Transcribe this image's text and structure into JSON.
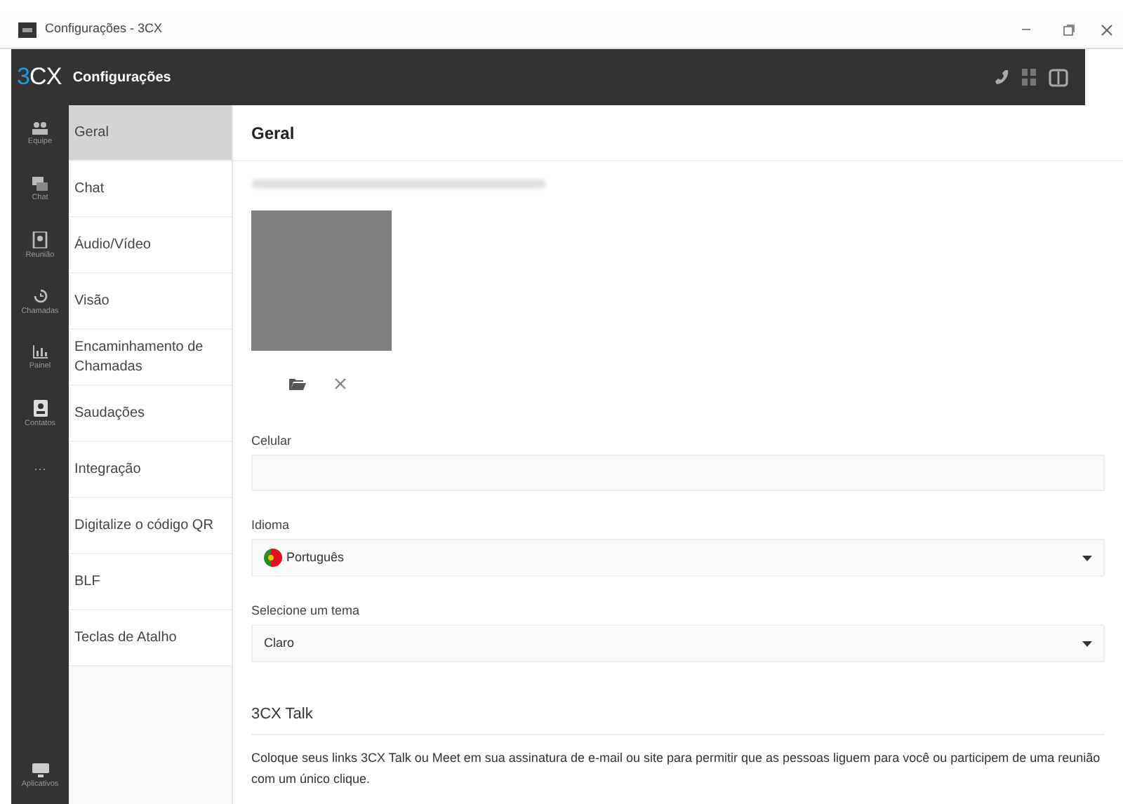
{
  "window": {
    "title": "Configurações - 3CX"
  },
  "header": {
    "logo": "3CX",
    "title": "Configurações"
  },
  "rail": [
    {
      "kind": "team",
      "label": "Equipe"
    },
    {
      "kind": "chat",
      "label": "Chat"
    },
    {
      "kind": "meeting",
      "label": "Reunião"
    },
    {
      "kind": "calls",
      "label": "Chamadas"
    },
    {
      "kind": "panel",
      "label": "Painel"
    },
    {
      "kind": "contacts",
      "label": "Contatos"
    },
    {
      "kind": "more",
      "label": "···"
    },
    {
      "kind": "apps",
      "label": "Aplicativos"
    }
  ],
  "nav": [
    {
      "label": "Geral",
      "selected": true
    },
    {
      "label": "Chat",
      "selected": false
    },
    {
      "label": "Áudio/Vídeo",
      "selected": false
    },
    {
      "label": "Visão",
      "selected": false
    },
    {
      "label": "Encaminhamento de Chamadas",
      "selected": false
    },
    {
      "label": "Saudações",
      "selected": false
    },
    {
      "label": "Integração",
      "selected": false
    },
    {
      "label": "Digitalize o código QR",
      "selected": false
    },
    {
      "label": "BLF",
      "selected": false
    },
    {
      "label": "Teclas de Atalho",
      "selected": false
    }
  ],
  "content": {
    "title": "Geral",
    "fields": [
      {
        "kind": "input",
        "label": "Celular"
      },
      {
        "kind": "select",
        "label": "Idioma",
        "value": "Português",
        "flag": true
      },
      {
        "kind": "select",
        "label": "Selecione um tema",
        "value": "Claro",
        "flag": false
      }
    ],
    "section": {
      "title": "3CX Talk",
      "text": "Coloque seus links 3CX Talk ou Meet em sua assinatura de e-mail ou site para permitir que as pessoas liguem para você ou participem de uma reunião com um único clique."
    }
  }
}
